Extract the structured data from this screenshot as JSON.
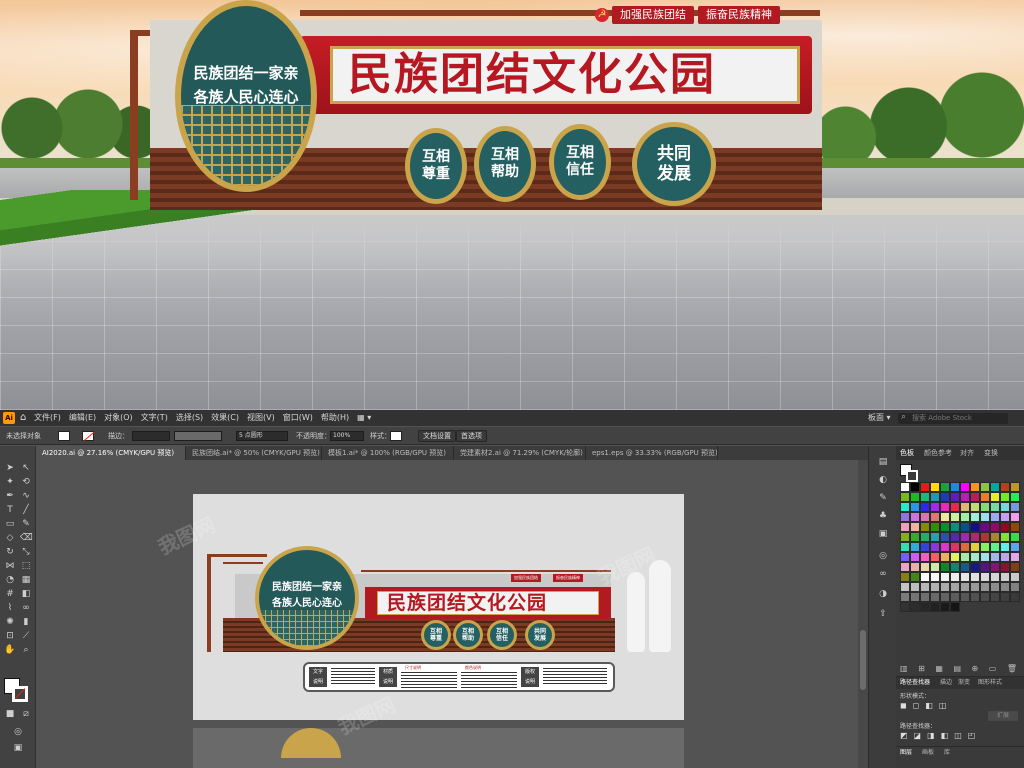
{
  "render": {
    "banner_title": "民族团结文化公园",
    "medal_line1": "民族团结一家亲",
    "medal_line2": "各族人民心连心",
    "tag1": "加强民族团结",
    "tag2": "振奋民族精神",
    "circles": [
      {
        "top": "互相",
        "bottom": "尊重"
      },
      {
        "top": "互相",
        "bottom": "帮助"
      },
      {
        "top": "互相",
        "bottom": "信任"
      },
      {
        "top": "共同",
        "bottom": "发展"
      }
    ]
  },
  "menubar": {
    "logo": "Ai",
    "items": [
      "文件(F)",
      "编辑(E)",
      "对象(O)",
      "文字(T)",
      "选择(S)",
      "效果(C)",
      "视图(V)",
      "窗口(W)",
      "帮助(H)"
    ],
    "workspace": "板面 ▾",
    "search_placeholder": "搜索 Adobe Stock"
  },
  "control": {
    "selection": "未选择对象",
    "stroke_label": "描边：",
    "brush": "5 点圆形",
    "opacity_label": "不透明度：",
    "opacity_value": "100%",
    "style_label": "样式：",
    "doc_settings": "文档设置",
    "preferences": "首选项"
  },
  "tabs": [
    "AI2020.ai @ 27.16% (CMYK/GPU 预览)",
    "民族团结.ai* @ 50% (CMYK/GPU 预览)",
    "模板1.ai* @ 100% (RGB/GPU 预览)",
    "党建素材2.ai @ 71.29% (CMYK/轮廓)",
    "eps1.eps @ 33.33% (RGB/GPU 预览)"
  ],
  "artboard": {
    "title": "民族团结文化公园",
    "medal_line1": "民族团结一家亲",
    "medal_line2": "各族人民心连心",
    "tag1": "加强民族团结",
    "tag2": "振奋民族精神",
    "circles": [
      {
        "top": "互相",
        "bottom": "尊重"
      },
      {
        "top": "互相",
        "bottom": "帮助"
      },
      {
        "top": "互相",
        "bottom": "信任"
      },
      {
        "top": "共同",
        "bottom": "发展"
      }
    ],
    "info_labels": [
      {
        "l1": "文字",
        "l2": "说明"
      },
      {
        "l1": "材质",
        "l2": "说明"
      },
      {
        "l1": "版权",
        "l2": "说明"
      }
    ],
    "info_heads": [
      "尺寸说明",
      "颜色说明"
    ]
  },
  "panels": {
    "swatch_tabs": [
      "色板",
      "颜色参考",
      "对齐",
      "变换"
    ],
    "pathfinder_tabs": [
      "路径查找器",
      "描边",
      "渐变",
      "图形样式"
    ],
    "shape_modes": "形状模式：",
    "pathfinders": "路径查找器：",
    "expand": "扩展",
    "layer_tabs": [
      "图层",
      "画板",
      "库"
    ]
  },
  "colors": {
    "accent_red": "#B51820",
    "teal": "#24595A",
    "gold": "#C9A44A",
    "ui_dark": "#323232",
    "ui_mid": "#424242",
    "canvas": "#535353"
  },
  "watermark": "我图网"
}
